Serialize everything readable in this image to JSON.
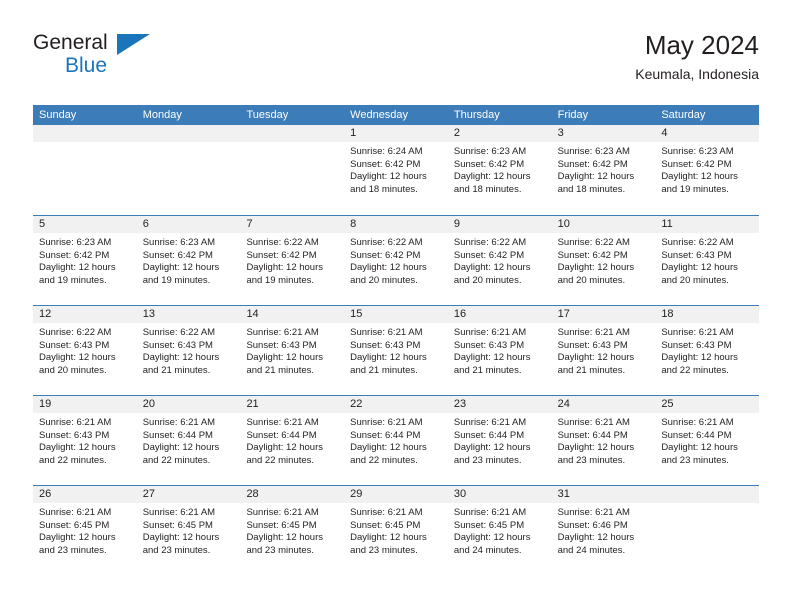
{
  "logo": {
    "word_general": "General",
    "word_blue": "Blue",
    "accent_color": "#1b75bb"
  },
  "header": {
    "title": "May 2024",
    "location": "Keumala, Indonesia"
  },
  "theme": {
    "header_blue": "#3c7cb8",
    "daynum_band": "#f1f1f1",
    "text": "#231f20"
  },
  "weekdays": [
    "Sunday",
    "Monday",
    "Tuesday",
    "Wednesday",
    "Thursday",
    "Friday",
    "Saturday"
  ],
  "weeks": [
    [
      {
        "day": "",
        "lines": []
      },
      {
        "day": "",
        "lines": []
      },
      {
        "day": "",
        "lines": []
      },
      {
        "day": "1",
        "lines": [
          "Sunrise: 6:24 AM",
          "Sunset: 6:42 PM",
          "Daylight: 12 hours",
          "and 18 minutes."
        ]
      },
      {
        "day": "2",
        "lines": [
          "Sunrise: 6:23 AM",
          "Sunset: 6:42 PM",
          "Daylight: 12 hours",
          "and 18 minutes."
        ]
      },
      {
        "day": "3",
        "lines": [
          "Sunrise: 6:23 AM",
          "Sunset: 6:42 PM",
          "Daylight: 12 hours",
          "and 18 minutes."
        ]
      },
      {
        "day": "4",
        "lines": [
          "Sunrise: 6:23 AM",
          "Sunset: 6:42 PM",
          "Daylight: 12 hours",
          "and 19 minutes."
        ]
      }
    ],
    [
      {
        "day": "5",
        "lines": [
          "Sunrise: 6:23 AM",
          "Sunset: 6:42 PM",
          "Daylight: 12 hours",
          "and 19 minutes."
        ]
      },
      {
        "day": "6",
        "lines": [
          "Sunrise: 6:23 AM",
          "Sunset: 6:42 PM",
          "Daylight: 12 hours",
          "and 19 minutes."
        ]
      },
      {
        "day": "7",
        "lines": [
          "Sunrise: 6:22 AM",
          "Sunset: 6:42 PM",
          "Daylight: 12 hours",
          "and 19 minutes."
        ]
      },
      {
        "day": "8",
        "lines": [
          "Sunrise: 6:22 AM",
          "Sunset: 6:42 PM",
          "Daylight: 12 hours",
          "and 20 minutes."
        ]
      },
      {
        "day": "9",
        "lines": [
          "Sunrise: 6:22 AM",
          "Sunset: 6:42 PM",
          "Daylight: 12 hours",
          "and 20 minutes."
        ]
      },
      {
        "day": "10",
        "lines": [
          "Sunrise: 6:22 AM",
          "Sunset: 6:42 PM",
          "Daylight: 12 hours",
          "and 20 minutes."
        ]
      },
      {
        "day": "11",
        "lines": [
          "Sunrise: 6:22 AM",
          "Sunset: 6:43 PM",
          "Daylight: 12 hours",
          "and 20 minutes."
        ]
      }
    ],
    [
      {
        "day": "12",
        "lines": [
          "Sunrise: 6:22 AM",
          "Sunset: 6:43 PM",
          "Daylight: 12 hours",
          "and 20 minutes."
        ]
      },
      {
        "day": "13",
        "lines": [
          "Sunrise: 6:22 AM",
          "Sunset: 6:43 PM",
          "Daylight: 12 hours",
          "and 21 minutes."
        ]
      },
      {
        "day": "14",
        "lines": [
          "Sunrise: 6:21 AM",
          "Sunset: 6:43 PM",
          "Daylight: 12 hours",
          "and 21 minutes."
        ]
      },
      {
        "day": "15",
        "lines": [
          "Sunrise: 6:21 AM",
          "Sunset: 6:43 PM",
          "Daylight: 12 hours",
          "and 21 minutes."
        ]
      },
      {
        "day": "16",
        "lines": [
          "Sunrise: 6:21 AM",
          "Sunset: 6:43 PM",
          "Daylight: 12 hours",
          "and 21 minutes."
        ]
      },
      {
        "day": "17",
        "lines": [
          "Sunrise: 6:21 AM",
          "Sunset: 6:43 PM",
          "Daylight: 12 hours",
          "and 21 minutes."
        ]
      },
      {
        "day": "18",
        "lines": [
          "Sunrise: 6:21 AM",
          "Sunset: 6:43 PM",
          "Daylight: 12 hours",
          "and 22 minutes."
        ]
      }
    ],
    [
      {
        "day": "19",
        "lines": [
          "Sunrise: 6:21 AM",
          "Sunset: 6:43 PM",
          "Daylight: 12 hours",
          "and 22 minutes."
        ]
      },
      {
        "day": "20",
        "lines": [
          "Sunrise: 6:21 AM",
          "Sunset: 6:44 PM",
          "Daylight: 12 hours",
          "and 22 minutes."
        ]
      },
      {
        "day": "21",
        "lines": [
          "Sunrise: 6:21 AM",
          "Sunset: 6:44 PM",
          "Daylight: 12 hours",
          "and 22 minutes."
        ]
      },
      {
        "day": "22",
        "lines": [
          "Sunrise: 6:21 AM",
          "Sunset: 6:44 PM",
          "Daylight: 12 hours",
          "and 22 minutes."
        ]
      },
      {
        "day": "23",
        "lines": [
          "Sunrise: 6:21 AM",
          "Sunset: 6:44 PM",
          "Daylight: 12 hours",
          "and 23 minutes."
        ]
      },
      {
        "day": "24",
        "lines": [
          "Sunrise: 6:21 AM",
          "Sunset: 6:44 PM",
          "Daylight: 12 hours",
          "and 23 minutes."
        ]
      },
      {
        "day": "25",
        "lines": [
          "Sunrise: 6:21 AM",
          "Sunset: 6:44 PM",
          "Daylight: 12 hours",
          "and 23 minutes."
        ]
      }
    ],
    [
      {
        "day": "26",
        "lines": [
          "Sunrise: 6:21 AM",
          "Sunset: 6:45 PM",
          "Daylight: 12 hours",
          "and 23 minutes."
        ]
      },
      {
        "day": "27",
        "lines": [
          "Sunrise: 6:21 AM",
          "Sunset: 6:45 PM",
          "Daylight: 12 hours",
          "and 23 minutes."
        ]
      },
      {
        "day": "28",
        "lines": [
          "Sunrise: 6:21 AM",
          "Sunset: 6:45 PM",
          "Daylight: 12 hours",
          "and 23 minutes."
        ]
      },
      {
        "day": "29",
        "lines": [
          "Sunrise: 6:21 AM",
          "Sunset: 6:45 PM",
          "Daylight: 12 hours",
          "and 23 minutes."
        ]
      },
      {
        "day": "30",
        "lines": [
          "Sunrise: 6:21 AM",
          "Sunset: 6:45 PM",
          "Daylight: 12 hours",
          "and 24 minutes."
        ]
      },
      {
        "day": "31",
        "lines": [
          "Sunrise: 6:21 AM",
          "Sunset: 6:46 PM",
          "Daylight: 12 hours",
          "and 24 minutes."
        ]
      },
      {
        "day": "",
        "lines": []
      }
    ]
  ]
}
